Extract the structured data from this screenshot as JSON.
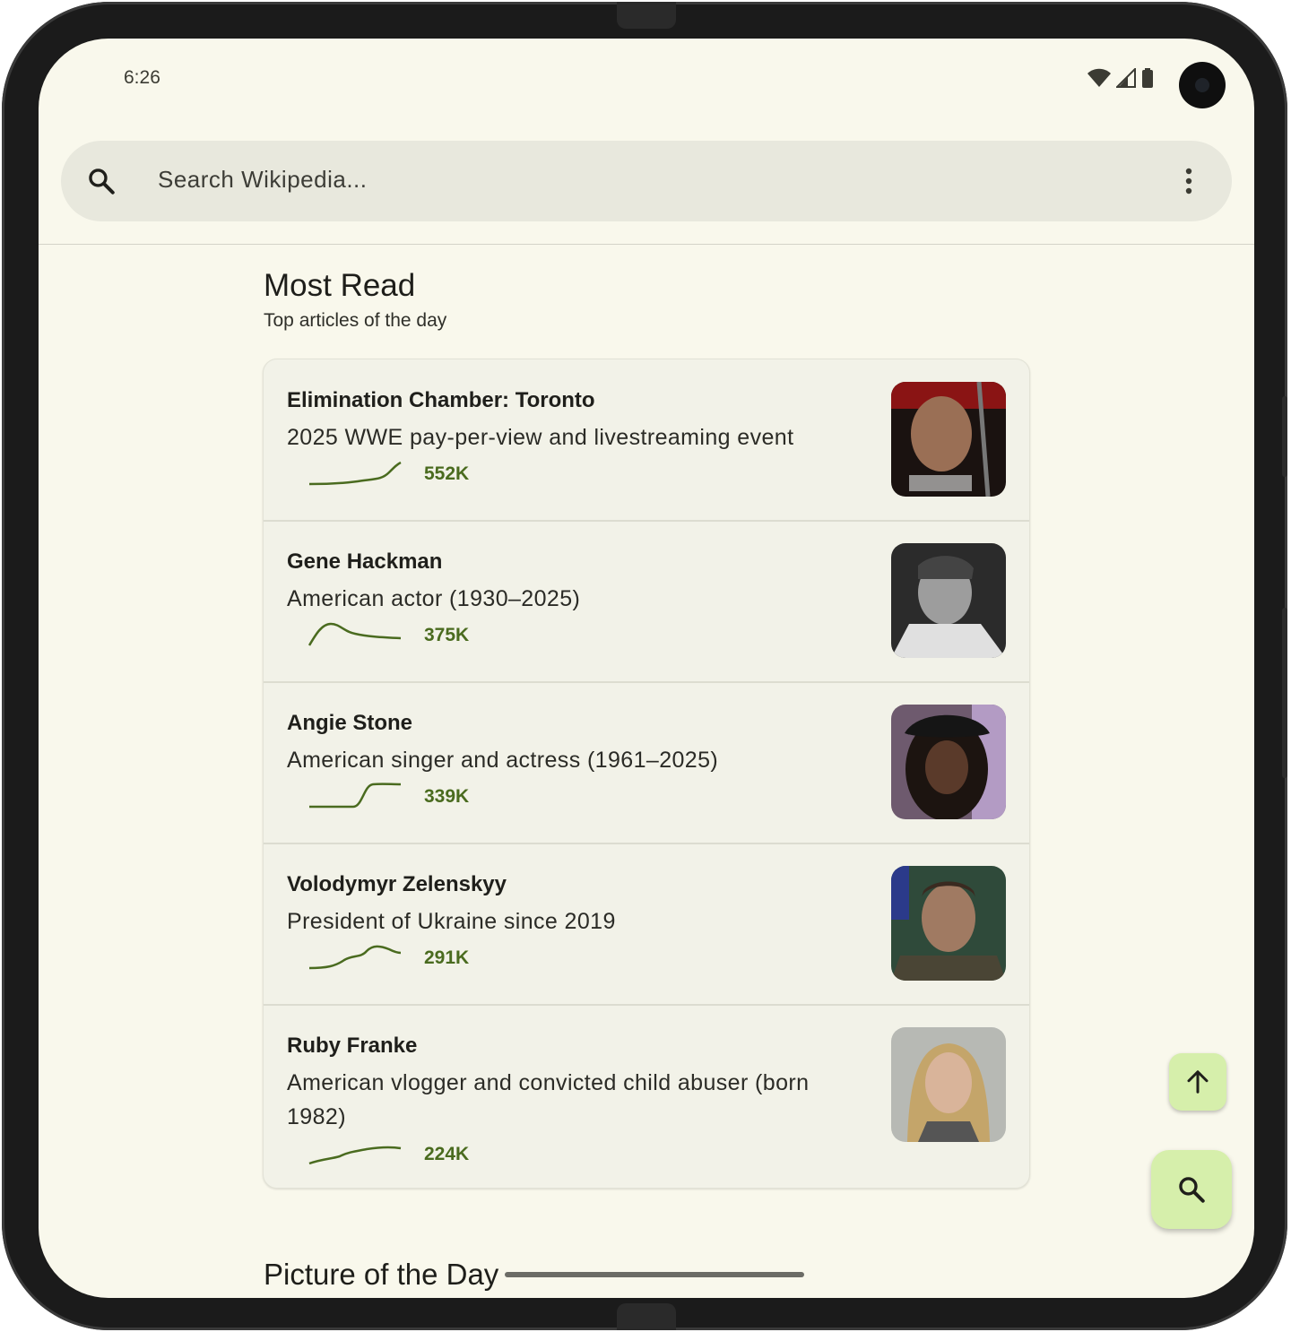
{
  "status_bar": {
    "time": "6:26"
  },
  "search": {
    "placeholder": "Search Wikipedia..."
  },
  "most_read": {
    "title": "Most Read",
    "subtitle": "Top articles of the day",
    "articles": [
      {
        "title": "Elimination Chamber: Toronto",
        "description": "2025 WWE pay-per-view and livestreaming event",
        "views": "552K"
      },
      {
        "title": "Gene Hackman",
        "description": "American actor (1930–2025)",
        "views": "375K"
      },
      {
        "title": "Angie Stone",
        "description": "American singer and actress (1961–2025)",
        "views": "339K"
      },
      {
        "title": "Volodymyr Zelenskyy",
        "description": "President of Ukraine since 2019",
        "views": "291K"
      },
      {
        "title": "Ruby Franke",
        "description": "American vlogger and convicted child abuser (born 1982)",
        "views": "224K"
      }
    ]
  },
  "next_section": {
    "title": "Picture of the Day"
  },
  "colors": {
    "background": "#f9f8ec",
    "accent": "#4a6b1f",
    "fab": "#d6efab"
  }
}
